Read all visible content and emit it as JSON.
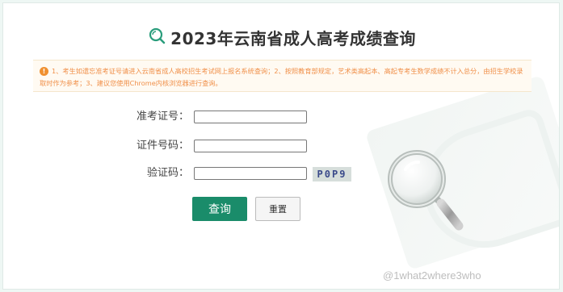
{
  "header": {
    "title": "2023年云南省成人高考成绩查询",
    "icon": "search-icon"
  },
  "notice": {
    "icon": "warning-icon",
    "text": "1、考生如遗忘准考证号请进入云南省成人高校招生考试网上报名系统查询；2、按照教育部规定，艺术类高起本、高起专考生数学成绩不计入总分，由招生学校录取时作为参考；3、建议您使用Chrome内核浏览器进行查询。"
  },
  "form": {
    "admission_label": "准考证号：",
    "admission_value": "",
    "id_label": "证件号码：",
    "id_value": "",
    "captcha_label": "验证码：",
    "captcha_value": "",
    "captcha_image_text": "P0P9"
  },
  "buttons": {
    "query_label": "查询",
    "reset_label": "重置"
  },
  "watermark": "@1what2where3who",
  "colors": {
    "accent": "#1a8c6a",
    "notice_text": "#f0904a",
    "notice_bg": "#fffaf2"
  }
}
